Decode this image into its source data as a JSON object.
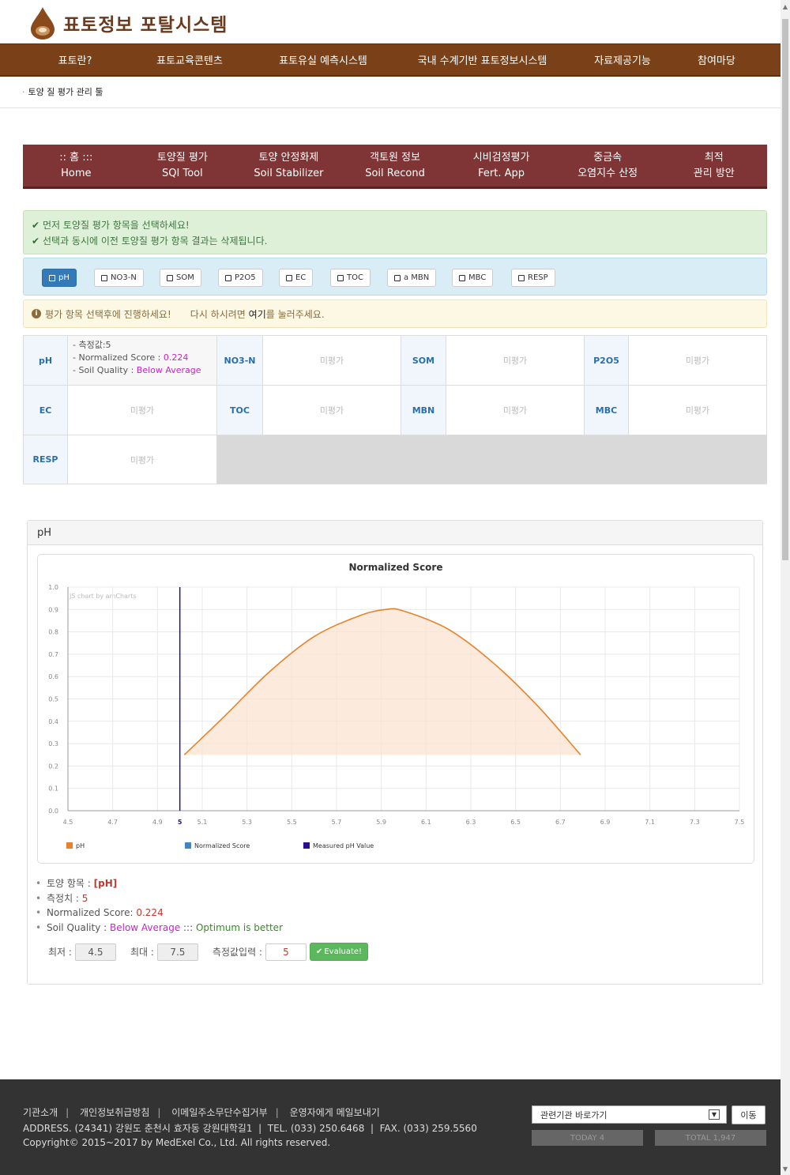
{
  "site": {
    "title": "표토정보 포탈시스템"
  },
  "topnav": [
    "표토란?",
    "표토교육콘텐츠",
    "표토유실 예측시스템",
    "국내 수계기반 표토정보시스템",
    "자료제공기능",
    "참여마당"
  ],
  "breadcrumb": "토양 질 평가 관리 툴",
  "subnav": [
    {
      "line1": ":: 홈 :::",
      "line2": "Home"
    },
    {
      "line1": "토양질 평가",
      "line2": "SQI Tool"
    },
    {
      "line1": "토양 안정화제",
      "line2": "Soil Stabilizer"
    },
    {
      "line1": "객토원 정보",
      "line2": "Soil Recond"
    },
    {
      "line1": "시비검정평가",
      "line2": "Fert. App"
    },
    {
      "line1": "중금속",
      "line2": "오염지수 산정"
    },
    {
      "line1": "최적",
      "line2": "관리 방안"
    }
  ],
  "alerts": {
    "ok_line1": "먼저 토양질 평가 항목을 선택하세요!",
    "ok_line2": "선택과 동시에 이전 토양질 평가 항목 결과는 삭제됩니다.",
    "warn": "평가 항목 선택후에 진행하세요!",
    "retry_prefix": "다시 하시려면",
    "retry_link": "여기",
    "retry_suffix": "를 눌러주세요."
  },
  "select_buttons": [
    {
      "label": "pH",
      "active": true
    },
    {
      "label": "NO3-N",
      "active": false
    },
    {
      "label": "SOM",
      "active": false
    },
    {
      "label": "P2O5",
      "active": false
    },
    {
      "label": "EC",
      "active": false
    },
    {
      "label": "TOC",
      "active": false
    },
    {
      "label": "a MBN",
      "active": false
    },
    {
      "label": "MBC",
      "active": false
    },
    {
      "label": "RESP",
      "active": false
    }
  ],
  "results": {
    "ph_label": "pH",
    "ph_measured": "- 측정값:5",
    "ph_score_prefix": "- Normalized Score : ",
    "ph_score": "0.224",
    "ph_quality_prefix": "- Soil Quality : ",
    "ph_quality": "Below Average",
    "not_evaluated": "미평가",
    "labels": [
      "NO3-N",
      "SOM",
      "P2O5",
      "EC",
      "TOC",
      "MBN",
      "MBC",
      "RESP"
    ]
  },
  "panel": {
    "title": "pH",
    "summary": {
      "item_label": "토양 항목 : ",
      "item_value": "[pH]",
      "measured_label": "측정치 : ",
      "measured_value": "5",
      "score_label": "Normalized Score: ",
      "score_value": "0.224",
      "quality_label": "Soil Quality : ",
      "quality_value": "Below Average",
      "quality_sep": " ::: ",
      "quality_note": "Optimum is better"
    },
    "min_label": "최저 :",
    "min_value": "4.5",
    "max_label": "최대 :",
    "max_value": "7.5",
    "input_label": "측정값입력 :",
    "input_value": "5",
    "evaluate_label": "Evaluate!"
  },
  "chart_data": {
    "type": "area",
    "title": "Normalized Score",
    "watermark": "JS chart by amCharts",
    "xlim": [
      4.5,
      7.5
    ],
    "ylim": [
      0,
      1.0
    ],
    "x_ticks": [
      "4.5",
      "4.7",
      "4.9",
      "5",
      "5.1",
      "5.3",
      "5.5",
      "5.7",
      "5.9",
      "6.1",
      "6.3",
      "6.5",
      "6.7",
      "6.9",
      "7.1",
      "7.3",
      "7.5"
    ],
    "y_ticks": [
      "0.0",
      "0.1",
      "0.2",
      "0.3",
      "0.4",
      "0.5",
      "0.6",
      "0.7",
      "0.8",
      "0.9",
      "1.0"
    ],
    "series": [
      {
        "name": "pH",
        "color": "#e8822a",
        "x": [
          5.02,
          5.2,
          5.4,
          5.6,
          5.8,
          5.92,
          6.0,
          6.2,
          6.4,
          6.6,
          6.79
        ],
        "y": [
          0.25,
          0.423,
          0.621,
          0.779,
          0.871,
          0.9,
          0.893,
          0.811,
          0.661,
          0.467,
          0.25
        ]
      },
      {
        "name": "Normalized Score",
        "color": "#3d87c9"
      },
      {
        "name": "Measured pH Value",
        "color": "#2a0f8f",
        "x": 5
      }
    ],
    "legend_position": "bottom",
    "grid": true
  },
  "footer": {
    "links": [
      "기관소개",
      "개인정보취급방침",
      "이메일주소무단수집거부",
      "운영자에게 메일보내기"
    ],
    "address": "ADDRESS. (24341) 강원도 춘천시 효자동 강원대학길1  |  TEL. (033) 250.6468  |  FAX. (033) 259.5560",
    "copyright": "Copyright© 2015~2017 by MedExel Co., Ltd. All rights reserved.",
    "select_label": "관련기관 바로가기",
    "go_label": "이동",
    "today": "TODAY 4",
    "total": "TOTAL 1,947"
  }
}
